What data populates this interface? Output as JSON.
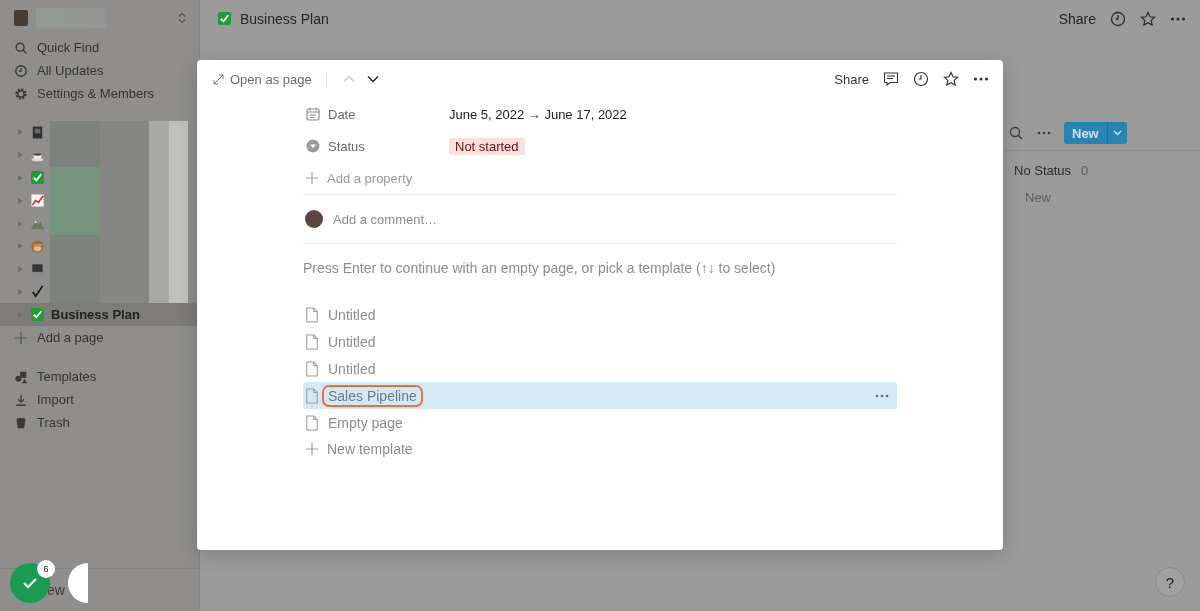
{
  "sidebar": {
    "quick_links": [
      {
        "kind": "search",
        "label": "Quick Find"
      },
      {
        "kind": "clock",
        "label": "All Updates"
      },
      {
        "kind": "gear",
        "label": "Settings & Members"
      }
    ],
    "pages": [
      {
        "kind": "notebook",
        "selected": false
      },
      {
        "kind": "coffee",
        "selected": false
      },
      {
        "kind": "check-box",
        "selected": false
      },
      {
        "kind": "chart",
        "selected": false
      },
      {
        "kind": "mountain",
        "selected": false
      },
      {
        "kind": "monkey",
        "selected": false
      },
      {
        "kind": "laptop",
        "selected": false
      },
      {
        "kind": "tick",
        "selected": false
      },
      {
        "kind": "check-box",
        "label": "Business Plan",
        "selected": true
      }
    ],
    "add_page": "Add a page",
    "bottom_links": [
      {
        "kind": "templates",
        "label": "Templates"
      },
      {
        "kind": "import",
        "label": "Import"
      },
      {
        "kind": "trash",
        "label": "Trash"
      }
    ],
    "new_page": "ew"
  },
  "checklist_badge": "6",
  "topbar": {
    "title": "Business Plan",
    "share": "Share"
  },
  "board": {
    "new_button": "New",
    "group": {
      "label": "No Status",
      "count": "0"
    },
    "add": "New"
  },
  "modal": {
    "open_as_page": "Open as page",
    "prev_disabled": true,
    "next_disabled": false,
    "share": "Share",
    "properties": [
      {
        "kind": "date",
        "name": "Date",
        "value": "June 5, 2022 → June 17, 2022"
      },
      {
        "kind": "status",
        "name": "Status",
        "value": "Not started"
      }
    ],
    "add_property": "Add a property",
    "comment_placeholder": "Add a comment…",
    "prompt": "Press Enter to continue with an empty page, or pick a template (↑↓ to select)",
    "templates": [
      {
        "label": "Untitled",
        "selected": false
      },
      {
        "label": "Untitled",
        "selected": false
      },
      {
        "label": "Untitled",
        "selected": false
      },
      {
        "label": "Sales Pipeline",
        "selected": true
      },
      {
        "label": "Empty page",
        "selected": false
      }
    ],
    "new_template": "New template"
  },
  "help": "?"
}
